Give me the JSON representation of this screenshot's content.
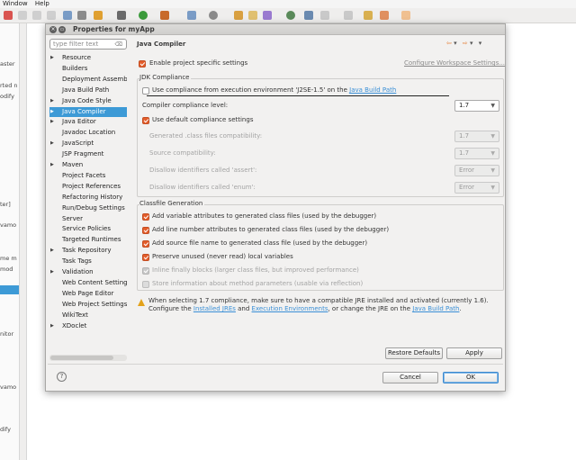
{
  "menubar": {
    "items": [
      "Window",
      "Help"
    ]
  },
  "background_left_texts": [
    "aster",
    "rted n",
    "odify",
    "ter]",
    "vamo",
    "me m",
    "mod",
    "nitor",
    "vamo",
    "dify"
  ],
  "dialog": {
    "title": "Properties for myApp",
    "close_glyph": "×",
    "menu_glyph": "▭",
    "filter_placeholder": "type filter text",
    "filter_clear": "⌫",
    "tree": [
      {
        "label": "Resource",
        "expandable": true
      },
      {
        "label": "Builders",
        "expandable": false
      },
      {
        "label": "Deployment Assembly",
        "expandable": false
      },
      {
        "label": "Java Build Path",
        "expandable": false
      },
      {
        "label": "Java Code Style",
        "expandable": true
      },
      {
        "label": "Java Compiler",
        "expandable": true,
        "selected": true
      },
      {
        "label": "Java Editor",
        "expandable": true
      },
      {
        "label": "Javadoc Location",
        "expandable": false
      },
      {
        "label": "JavaScript",
        "expandable": true
      },
      {
        "label": "JSP Fragment",
        "expandable": false
      },
      {
        "label": "Maven",
        "expandable": true
      },
      {
        "label": "Project Facets",
        "expandable": false
      },
      {
        "label": "Project References",
        "expandable": false
      },
      {
        "label": "Refactoring History",
        "expandable": false
      },
      {
        "label": "Run/Debug Settings",
        "expandable": false
      },
      {
        "label": "Server",
        "expandable": false
      },
      {
        "label": "Service Policies",
        "expandable": false
      },
      {
        "label": "Targeted Runtimes",
        "expandable": false
      },
      {
        "label": "Task Repository",
        "expandable": true
      },
      {
        "label": "Task Tags",
        "expandable": false
      },
      {
        "label": "Validation",
        "expandable": true
      },
      {
        "label": "Web Content Settings",
        "expandable": false
      },
      {
        "label": "Web Page Editor",
        "expandable": false
      },
      {
        "label": "Web Project Settings",
        "expandable": false
      },
      {
        "label": "WikiText",
        "expandable": false
      },
      {
        "label": "XDoclet",
        "expandable": true
      }
    ],
    "page_title": "Java Compiler",
    "nav": {
      "back": "⇦",
      "forward": "⇨",
      "dropdown": "▾",
      "menu": "▾"
    },
    "enable_project_specific": "Enable project specific settings",
    "configure_workspace": "Configure Workspace Settings...",
    "jdk_group": {
      "title": "JDK Compliance",
      "use_compliance_prefix": "Use compliance from execution environment 'J2SE-1.5' on the ",
      "use_compliance_link": "Java Build Path",
      "compiler_level_label": "Compiler compliance level:",
      "compiler_level_value": "1.7",
      "use_default": "Use default compliance settings",
      "generated_label": "Generated .class files compatibility:",
      "generated_value": "1.7",
      "source_label": "Source compatibility:",
      "source_value": "1.7",
      "assert_label": "Disallow identifiers called 'assert':",
      "assert_value": "Error",
      "enum_label": "Disallow identifiers called 'enum':",
      "enum_value": "Error"
    },
    "classfile_group": {
      "title": "Classfile Generation",
      "opt1": "Add variable attributes to generated class files (used by the debugger)",
      "opt2": "Add line number attributes to generated class files (used by the debugger)",
      "opt3": "Add source file name to generated class file (used by the debugger)",
      "opt4": "Preserve unused (never read) local variables",
      "opt5": "Inline finally blocks (larger class files, but improved performance)",
      "opt6": "Store information about method parameters (usable via reflection)"
    },
    "warning": {
      "line1": "When selecting 1.7 compliance, make sure to have a compatible JRE installed and activated (currently 1.6).",
      "l2_a": "Configure the ",
      "l2_link1": "Installed JREs",
      "l2_b": " and ",
      "l2_link2": "Execution Environments",
      "l2_c": ", or change the JRE on the ",
      "l2_link3": "Java Build Path",
      "l2_d": "."
    },
    "restore_defaults": "Restore Defaults",
    "apply": "Apply",
    "cancel": "Cancel",
    "ok": "OK",
    "help_glyph": "?"
  }
}
